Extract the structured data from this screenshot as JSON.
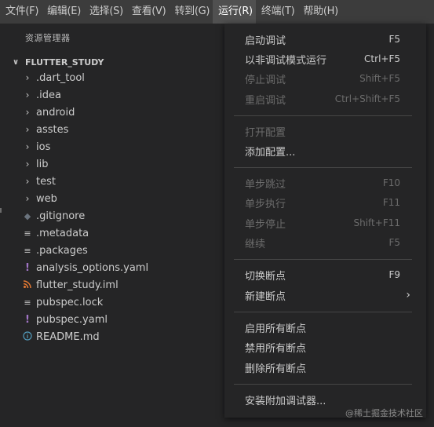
{
  "menubar": {
    "items": [
      "文件(F)",
      "编辑(E)",
      "选择(S)",
      "查看(V)",
      "转到(G)",
      "运行(R)",
      "终端(T)",
      "帮助(H)"
    ]
  },
  "explorer": {
    "title": "资源管理器",
    "root": "FLUTTER_STUDY",
    "items": [
      {
        "label": ".dart_tool",
        "icon": "chevron-right"
      },
      {
        "label": ".idea",
        "icon": "chevron-right"
      },
      {
        "label": "android",
        "icon": "chevron-right"
      },
      {
        "label": "asstes",
        "icon": "chevron-right"
      },
      {
        "label": "ios",
        "icon": "chevron-right"
      },
      {
        "label": "lib",
        "icon": "chevron-right"
      },
      {
        "label": "test",
        "icon": "chevron-right"
      },
      {
        "label": "web",
        "icon": "chevron-right"
      },
      {
        "label": ".gitignore",
        "icon": "git-diamond"
      },
      {
        "label": ".metadata",
        "icon": "lines"
      },
      {
        "label": ".packages",
        "icon": "lines"
      },
      {
        "label": "analysis_options.yaml",
        "icon": "exclamation"
      },
      {
        "label": "flutter_study.iml",
        "icon": "rss"
      },
      {
        "label": "pubspec.lock",
        "icon": "lines"
      },
      {
        "label": "pubspec.yaml",
        "icon": "exclamation"
      },
      {
        "label": "README.md",
        "icon": "info"
      }
    ]
  },
  "run_menu": {
    "start_debugging": {
      "label": "启动调试",
      "shortcut": "F5"
    },
    "run_without_debugging": {
      "label": "以非调试模式运行",
      "shortcut": "Ctrl+F5"
    },
    "stop_debugging": {
      "label": "停止调试",
      "shortcut": "Shift+F5"
    },
    "restart_debugging": {
      "label": "重启调试",
      "shortcut": "Ctrl+Shift+F5"
    },
    "open_config": {
      "label": "打开配置"
    },
    "add_config": {
      "label": "添加配置..."
    },
    "step_over": {
      "label": "单步跳过",
      "shortcut": "F10"
    },
    "step_into": {
      "label": "单步执行",
      "shortcut": "F11"
    },
    "step_out": {
      "label": "单步停止",
      "shortcut": "Shift+F11"
    },
    "continue": {
      "label": "继续",
      "shortcut": "F5"
    },
    "toggle_breakpoint": {
      "label": "切换断点",
      "shortcut": "F9"
    },
    "new_breakpoint": {
      "label": "新建断点"
    },
    "enable_all": {
      "label": "启用所有断点"
    },
    "disable_all": {
      "label": "禁用所有断点"
    },
    "remove_all": {
      "label": "删除所有断点"
    },
    "install_debuggers": {
      "label": "安装附加调试器..."
    }
  },
  "watermark": "@稀土掘金技术社区",
  "colors": {
    "background": "#252526",
    "menubar": "#3c3c3c",
    "active_menu": "#505050",
    "disabled_text": "#6b6b6b"
  }
}
